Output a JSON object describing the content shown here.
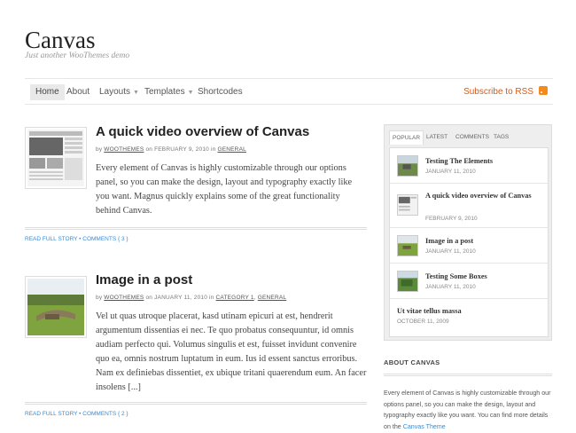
{
  "site": {
    "title": "Canvas",
    "tagline": "Just another WooThemes demo"
  },
  "nav": {
    "home": "Home",
    "about": "About",
    "layouts": "Layouts",
    "templates": "Templates",
    "shortcodes": "Shortcodes",
    "subscribe": "Subscribe to RSS"
  },
  "posts": [
    {
      "title": "A quick video overview of Canvas",
      "meta_by": "by",
      "author": "WOOTHEMES",
      "meta_on": "on",
      "date": "FEBRUARY 9, 2010",
      "meta_in": "in",
      "categories": [
        "GENERAL"
      ],
      "text": "Every element of Canvas is highly customizable through our options panel, so you can make the design, layout and typography exactly like you want. Magnus quickly explains some of the great functionality behind Canvas.",
      "read_more": "READ FULL STORY",
      "comments": "COMMENTS { 3 }"
    },
    {
      "title": "Image in a post",
      "meta_by": "by",
      "author": "WOOTHEMES",
      "meta_on": "on",
      "date": "JANUARY 11, 2010",
      "meta_in": "in",
      "categories": [
        "CATEGORY 1",
        "GENERAL"
      ],
      "text": "Vel ut quas utroque placerat, kasd utinam epicuri at est, hendrerit argumentum dissentias ei nec. Te quo probatus consequuntur, id omnis audiam perfecto qui. Volumus singulis et est, fuisset invidunt convenire quo ea, omnis nostrum luptatum in eum. Ius id essent sanctus erroribus. Nam ex definiebas dissentiet, ex ubique tritani quaerendum eum. An facer insolens [...]",
      "read_more": "READ FULL STORY",
      "comments": "COMMENTS { 2 }"
    }
  ],
  "tabs": {
    "labels": [
      "POPULAR",
      "LATEST",
      "COMMENTS",
      "TAGS"
    ],
    "active": "POPULAR",
    "items": [
      {
        "title": "Testing The Elements",
        "date": "JANUARY 11, 2010"
      },
      {
        "title": "A quick video overview of Canvas",
        "date": "FEBRUARY 9, 2010"
      },
      {
        "title": "Image in a post",
        "date": "JANUARY 11, 2010"
      },
      {
        "title": "Testing Some Boxes",
        "date": "JANUARY 11, 2010"
      },
      {
        "title": "Ut vitae tellus massa",
        "date": "OCTOBER 11, 2009"
      }
    ]
  },
  "about": {
    "title": "ABOUT CANVAS",
    "text": "Every element of Canvas is highly customizable through our options panel, so you can make the design, layout and typography exactly like you want. You can find more details on the",
    "link": "Canvas Theme"
  },
  "colors": {
    "accent": "#3a8ad2",
    "subscribe": "#d35a1a",
    "rss": "#f28a1d"
  }
}
